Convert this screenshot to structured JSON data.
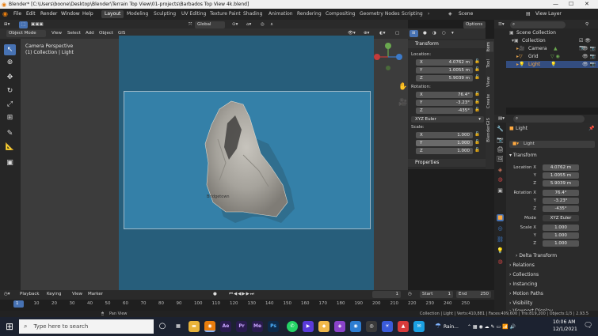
{
  "window": {
    "title": "Blender* [C:\\Users\\boone\\Desktop\\Blender\\Terrain Top View\\01-projects\\Barbados Top View 4k.blend]"
  },
  "menu": [
    "File",
    "Edit",
    "Render",
    "Window",
    "Help"
  ],
  "workspaces": [
    "Layout",
    "Modeling",
    "Sculpting",
    "UV Editing",
    "Texture Paint",
    "Shading",
    "Animation",
    "Rendering",
    "Compositing",
    "Geometry Nodes",
    "Scripting"
  ],
  "scene": {
    "scene_label": "Scene",
    "view_layer": "View Layer"
  },
  "header": {
    "orientation": "Global",
    "options": "Options"
  },
  "header2": {
    "mode": "Object Mode",
    "items": [
      "View",
      "Select",
      "Add",
      "Object",
      "GIS"
    ]
  },
  "viewport": {
    "line1": "Camera Perspective",
    "line2": "(1) Collection | Light",
    "place_label": "Bridgetown"
  },
  "npanel": {
    "transform": "Transform",
    "location_label": "Location:",
    "location": [
      {
        "k": "X",
        "v": "4.0762 m"
      },
      {
        "k": "Y",
        "v": "1.0055 m"
      },
      {
        "k": "Z",
        "v": "5.9039 m"
      }
    ],
    "rotation_label": "Rotation:",
    "rotation": [
      {
        "k": "X",
        "v": "76.4°"
      },
      {
        "k": "Y",
        "v": "-3.23°"
      },
      {
        "k": "Z",
        "v": "-435°"
      }
    ],
    "euler": "XYZ Euler",
    "scale_label": "Scale:",
    "scale": [
      {
        "k": "X",
        "v": "1.000"
      },
      {
        "k": "Y",
        "v": "1.000"
      },
      {
        "k": "Z",
        "v": "1.000"
      }
    ],
    "properties": "Properties",
    "tabs": [
      "Item",
      "Tool",
      "View",
      "Create",
      "BlenderGIS"
    ]
  },
  "outliner": {
    "root": "Scene Collection",
    "items": [
      {
        "name": "Collection"
      },
      {
        "name": "Camera"
      },
      {
        "name": "Grid"
      },
      {
        "name": "Light"
      }
    ]
  },
  "props": {
    "object_name": "Light",
    "object_field": "Light",
    "transform": "Transform",
    "loc_x_label": "Location X",
    "loc_x": "4.0762 m",
    "loc_y_label": "Y",
    "loc_y": "1.0055 m",
    "loc_z_label": "Z",
    "loc_z": "5.9039 m",
    "rot_x_label": "Rotation X",
    "rot_x": "76.4°",
    "rot_y_label": "Y",
    "rot_y": "-3.23°",
    "rot_z_label": "Z",
    "rot_z": "-435°",
    "mode_label": "Mode",
    "mode": "XYZ Euler",
    "scale_x_label": "Scale X",
    "scale_x": "1.000",
    "scale_y_label": "Y",
    "scale_y": "1.000",
    "scale_z_label": "Z",
    "scale_z": "1.000",
    "sections": [
      "Delta Transform",
      "Relations",
      "Collections",
      "Instancing",
      "Motion Paths",
      "Visibility",
      "Viewport Display"
    ]
  },
  "timeline": {
    "items": [
      "Playback",
      "Keying",
      "View",
      "Marker"
    ],
    "current": "1",
    "start_label": "Start",
    "start": "1",
    "end_label": "End",
    "end": "250",
    "ticks": [
      "1",
      "10",
      "20",
      "30",
      "40",
      "50",
      "60",
      "70",
      "80",
      "90",
      "100",
      "110",
      "120",
      "130",
      "140",
      "150",
      "160",
      "170",
      "180",
      "190",
      "200",
      "210",
      "220",
      "230",
      "240",
      "250"
    ]
  },
  "status": {
    "left": "Pan View",
    "right": "Collection | Light | Verts:410,881 | Faces:409,600 | Tris:819,200 | Objects:1/3 | 2.93.5"
  },
  "taskbar": {
    "search": "Type here to search",
    "weather": "Rain...",
    "time": "10:06 AM",
    "date": "12/1/2021",
    "apps": [
      {
        "t": "Ae",
        "c": "#2a1b4e"
      },
      {
        "t": "Pr",
        "c": "#2a1b4e"
      },
      {
        "t": "Me",
        "c": "#2a1b4e"
      },
      {
        "t": "Ps",
        "c": "#0d2a4a"
      }
    ]
  },
  "colors": {
    "accent": "#4772b3",
    "ocean": "#3480a8",
    "selected": "#ffaa40"
  }
}
